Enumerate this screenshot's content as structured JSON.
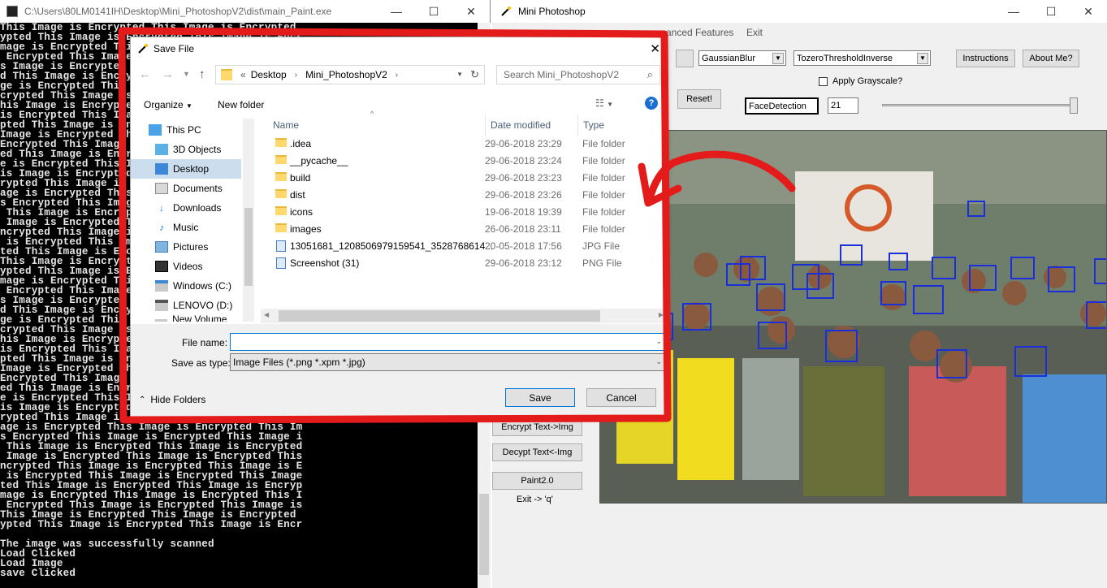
{
  "console": {
    "title": "C:\\Users\\80LM0141IH\\Desktop\\Mini_PhotoshopV2\\dist\\main_Paint.exe",
    "encrypted_text": "This Image is Encrypted ",
    "footer_lines": [
      "The image was successfully scanned",
      "Load Clicked",
      "Load Image",
      "save Clicked"
    ]
  },
  "app": {
    "title": "Mini Photoshop",
    "menu": [
      "anced Features",
      "Exit"
    ],
    "combo_blur": "GaussianBlur",
    "combo_threshold": "TozeroThresholdInverse",
    "instructions_button": "Instructions",
    "about_button": "About Me?",
    "grayscale_label": "Apply Grayscale?",
    "reset_button": "Reset!",
    "detection_field": "FaceDetection",
    "slider_value": "21",
    "encrypt_button": "Encrypt Text->Img",
    "decrypt_button": "Decypt Text<-Img",
    "paint_button": "Paint2.0",
    "exit_hint": "Exit -> 'q'"
  },
  "dialog": {
    "title": "Save File",
    "path": [
      "Desktop",
      "Mini_PhotoshopV2"
    ],
    "search_placeholder": "Search Mini_PhotoshopV2",
    "organize": "Organize",
    "new_folder": "New folder",
    "nav_items": [
      "This PC",
      "3D Objects",
      "Desktop",
      "Documents",
      "Downloads",
      "Music",
      "Pictures",
      "Videos",
      "Windows (C:)",
      "LENOVO (D:)",
      "New Volume (E:)"
    ],
    "columns": [
      "Name",
      "Date modified",
      "Type"
    ],
    "files": [
      {
        "name": ".idea",
        "date": "29-06-2018 23:29",
        "type": "File folder",
        "kind": "folder"
      },
      {
        "name": "__pycache__",
        "date": "29-06-2018 23:24",
        "type": "File folder",
        "kind": "folder"
      },
      {
        "name": "build",
        "date": "29-06-2018 23:23",
        "type": "File folder",
        "kind": "folder"
      },
      {
        "name": "dist",
        "date": "29-06-2018 23:26",
        "type": "File folder",
        "kind": "folder"
      },
      {
        "name": "icons",
        "date": "19-06-2018 19:39",
        "type": "File folder",
        "kind": "folder"
      },
      {
        "name": "images",
        "date": "26-06-2018 23:11",
        "type": "File folder",
        "kind": "folder"
      },
      {
        "name": "13051681_1208506979159541_3528768614...",
        "date": "20-05-2018 17:56",
        "type": "JPG File",
        "kind": "image"
      },
      {
        "name": "Screenshot (31)",
        "date": "29-06-2018 23:12",
        "type": "PNG File",
        "kind": "image"
      }
    ],
    "file_name_label": "File name:",
    "file_name_value": "",
    "save_type_label": "Save as type:",
    "save_type_value": "Image Files (*.png *.xpm *.jpg)",
    "hide_folders": "Hide Folders",
    "save_button": "Save",
    "cancel_button": "Cancel"
  },
  "colors": {
    "highlight": "#e31b1b",
    "accent": "#0078d7",
    "console_bg": "#000000"
  }
}
